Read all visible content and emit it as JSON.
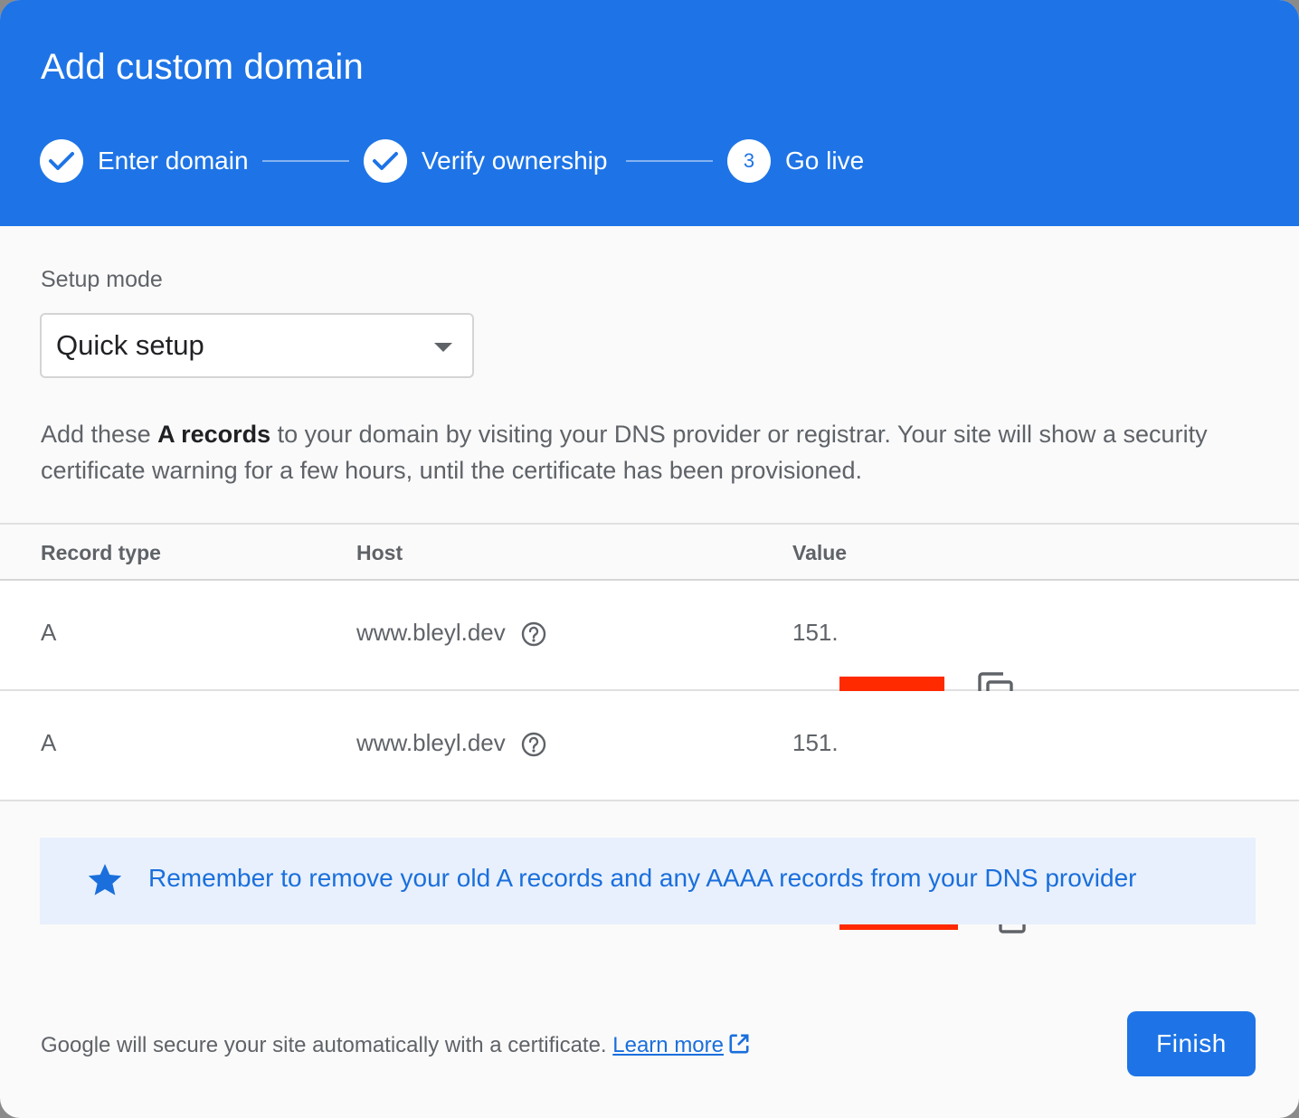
{
  "dialog": {
    "title": "Add custom domain"
  },
  "stepper": {
    "steps": [
      {
        "label": "Enter domain",
        "state": "complete"
      },
      {
        "label": "Verify ownership",
        "state": "complete"
      },
      {
        "label": "Go live",
        "number": "3",
        "state": "active"
      }
    ]
  },
  "setup": {
    "label": "Setup mode",
    "selected": "Quick setup"
  },
  "description": {
    "prefix": "Add these ",
    "emphasis": "A records",
    "suffix": " to your domain by visiting your DNS provider or registrar. Your site will show a security certificate warning for a few hours, until the certificate has been provisioned."
  },
  "table": {
    "headers": {
      "type": "Record type",
      "host": "Host",
      "value": "Value"
    },
    "rows": [
      {
        "type": "A",
        "host": "www.bleyl.dev",
        "value": "151."
      },
      {
        "type": "A",
        "host": "www.bleyl.dev",
        "value": "151."
      }
    ]
  },
  "notice": {
    "text": "Remember to remove your old A records and any AAAA records from your DNS provider"
  },
  "footer": {
    "text": "Google will secure your site automatically with a certificate. ",
    "link": "Learn more",
    "finish": "Finish"
  },
  "colors": {
    "primary": "#1e74e6",
    "redaction": "#ff2a00",
    "notice_bg": "#e8f0fd"
  }
}
